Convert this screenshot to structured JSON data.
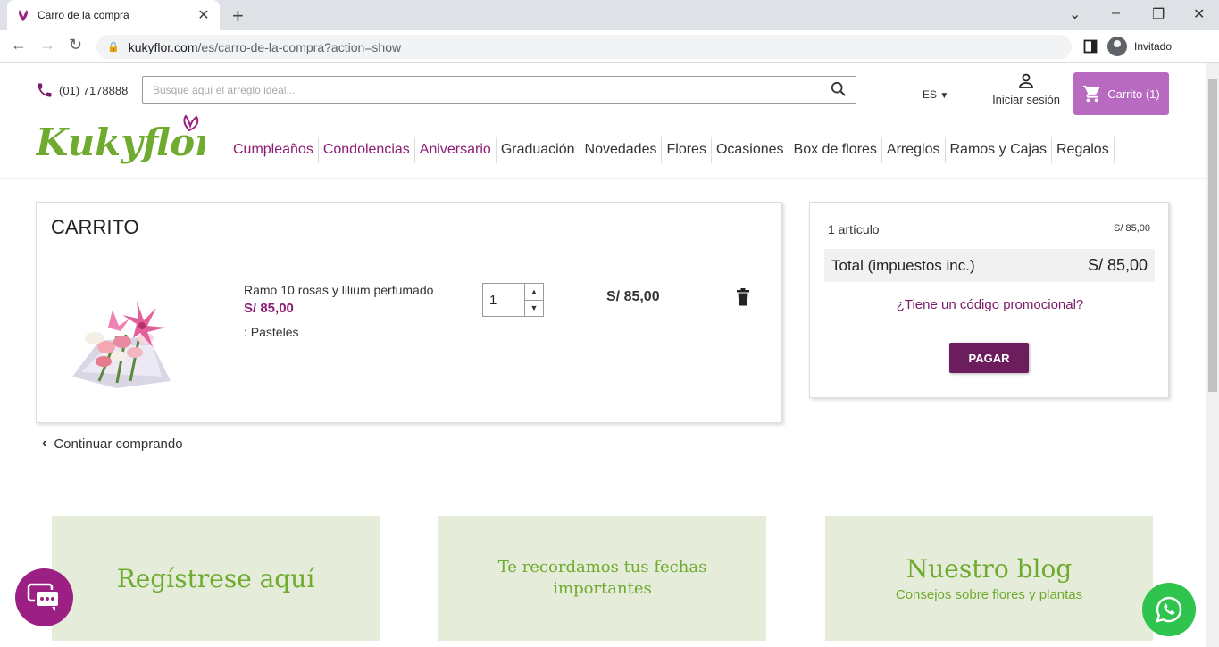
{
  "browser": {
    "tab_title": "Carro de la compra",
    "url_host": "kukyflor.com",
    "url_path": "/es/carro-de-la-compra?action=show",
    "profile_label": "Invitado"
  },
  "header": {
    "phone": "(01) 7178888",
    "search_placeholder": "Busque aquí el arreglo ideal...",
    "lang": "ES",
    "login_label": "Iniciar sesión",
    "cart_label": "Carrito (1)",
    "logo_text": "Kukyflor"
  },
  "nav": [
    {
      "label": "Cumpleaños",
      "highlight": true
    },
    {
      "label": "Condolencias",
      "highlight": true
    },
    {
      "label": "Aniversario",
      "highlight": true
    },
    {
      "label": "Graduación",
      "highlight": false
    },
    {
      "label": "Novedades",
      "highlight": false
    },
    {
      "label": "Flores",
      "highlight": false
    },
    {
      "label": "Ocasiones",
      "highlight": false
    },
    {
      "label": "Box de flores",
      "highlight": false
    },
    {
      "label": "Arreglos",
      "highlight": false
    },
    {
      "label": "Ramos y Cajas",
      "highlight": false
    },
    {
      "label": "Regalos",
      "highlight": false
    }
  ],
  "cart": {
    "title": "CARRITO",
    "item": {
      "name": "Ramo 10 rosas y lilium perfumado",
      "unit_price": "S/ 85,00",
      "attribute": ": Pasteles",
      "quantity": "1",
      "total": "S/ 85,00"
    },
    "continue_label": "Continuar comprando"
  },
  "summary": {
    "items_label": "1 artículo",
    "items_price": "S/ 85,00",
    "total_label": "Total (impuestos inc.)",
    "total_value": "S/ 85,00",
    "promo_label": "¿Tiene un código promocional?",
    "pay_label": "PAGAR"
  },
  "banners": {
    "register": "Regístrese aquí",
    "reminder": "Te recordamos tus fechas importantes",
    "blog_title": "Nuestro blog",
    "blog_subtitle": "Consejos sobre flores y plantas"
  },
  "colors": {
    "brand_purple": "#8c1c74",
    "cart_button": "#b86ac1",
    "pay_button": "#6b1d5e",
    "brand_green": "#6eab2f",
    "banner_bg": "#e5ecd9",
    "whatsapp": "#2ec44e"
  }
}
